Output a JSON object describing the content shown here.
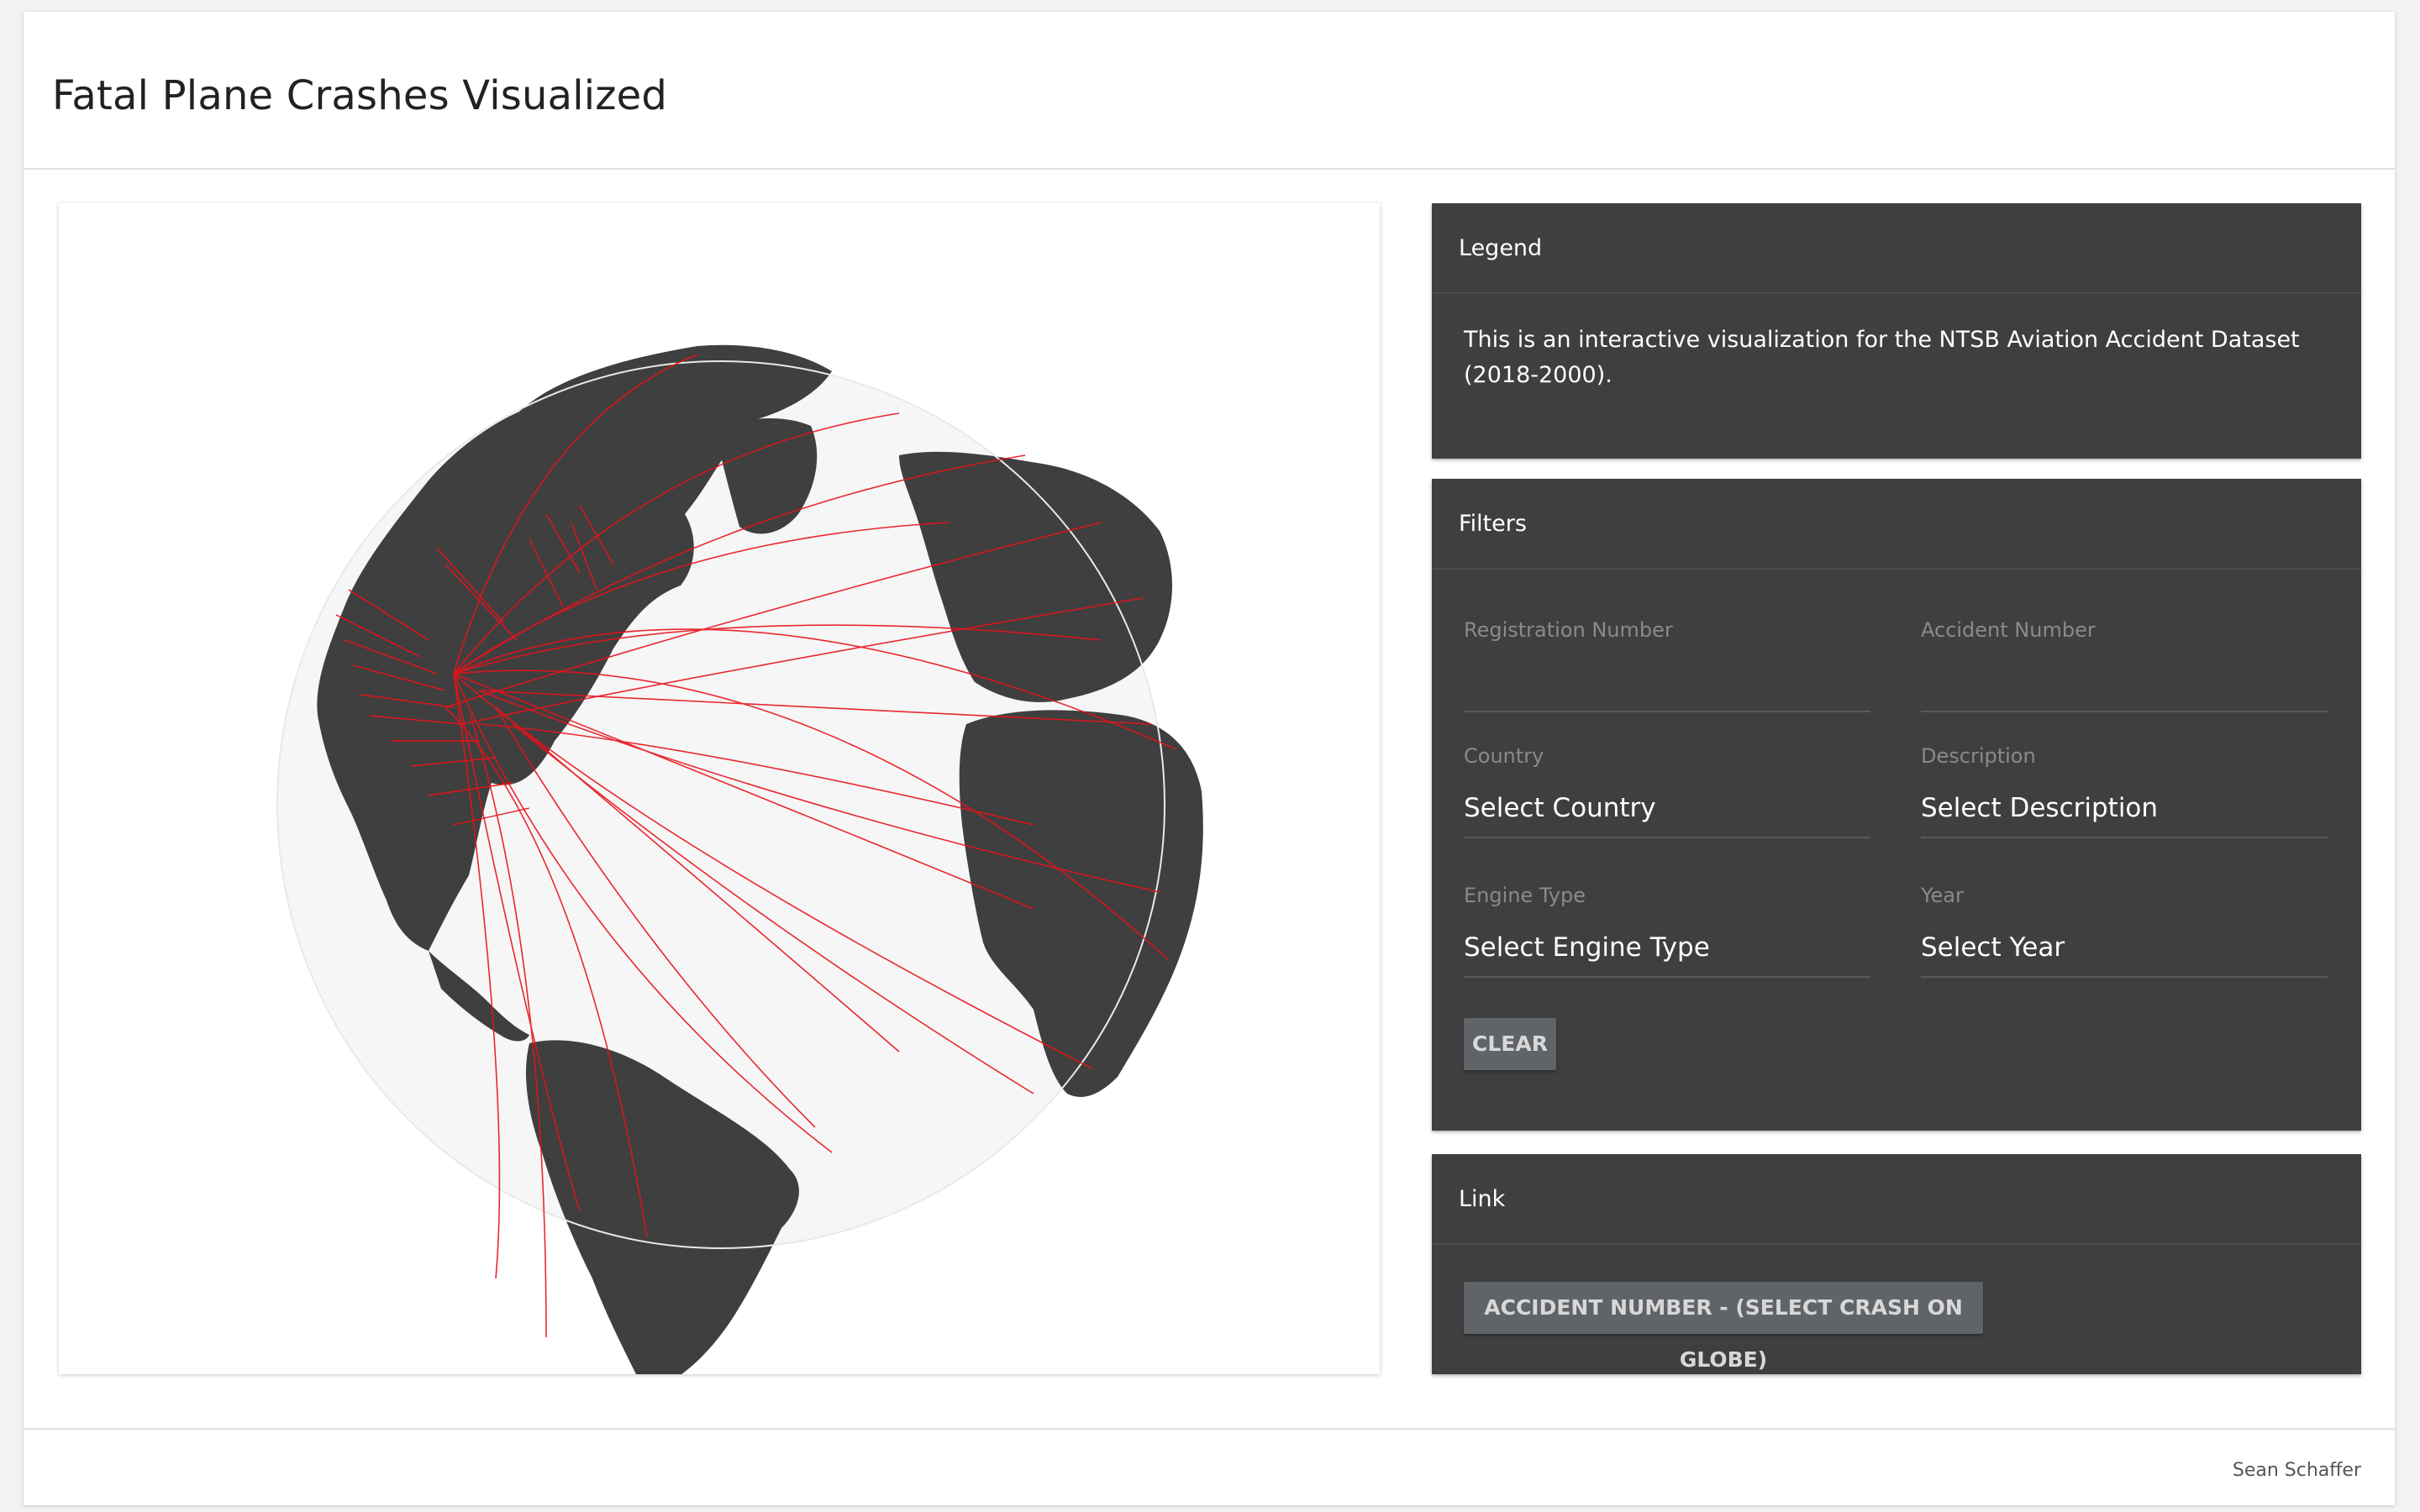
{
  "header": {
    "title": "Fatal Plane Crashes Visualized"
  },
  "legend": {
    "title": "Legend",
    "text": "This is an interactive visualization for the NTSB Aviation Accident Dataset (2018-2000)."
  },
  "filters": {
    "title": "Filters",
    "registration_label": "Registration Number",
    "registration_value": "",
    "accident_label": "Accident Number",
    "accident_value": "",
    "country_label": "Country",
    "country_value": "Select Country",
    "description_label": "Description",
    "description_value": "Select Description",
    "engine_label": "Engine Type",
    "engine_value": "Select Engine Type",
    "year_label": "Year",
    "year_value": "Select Year",
    "clear_label": "CLEAR"
  },
  "link": {
    "title": "Link",
    "button_label": "ACCIDENT NUMBER - (SELECT CRASH ON GLOBE)"
  },
  "footer": {
    "author": "Sean Schaffer"
  },
  "colors": {
    "globe_ocean": "#f6f6f6",
    "land": "#3f3f3f",
    "crash_arc": "#e8121a",
    "panel_bg": "#3f3f3f"
  },
  "icons": {}
}
